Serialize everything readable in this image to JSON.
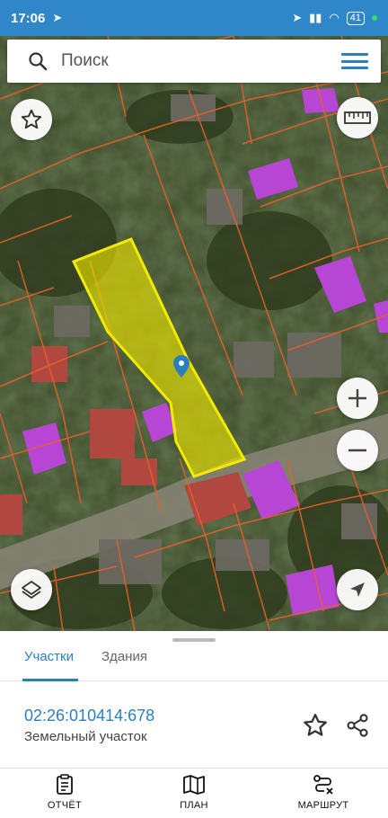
{
  "status_bar": {
    "time": "17:06",
    "battery": "41"
  },
  "search": {
    "placeholder": "Поиск"
  },
  "sheet": {
    "tabs": [
      {
        "label": "Участки",
        "active": true
      },
      {
        "label": "Здания",
        "active": false
      }
    ],
    "parcel": {
      "id": "02:26:010414:678",
      "type": "Земельный участок"
    }
  },
  "bottom_nav": [
    {
      "label": "ОТЧЁТ",
      "icon": "report-icon"
    },
    {
      "label": "ПЛАН",
      "icon": "map-plan-icon"
    },
    {
      "label": "МАРШРУТ",
      "icon": "route-icon"
    }
  ],
  "colors": {
    "accent": "#2a7fbf",
    "status_bar": "#2f86c8",
    "selected_parcel": "#e8e000",
    "building": "#c04fd8",
    "boundary": "#e8602a"
  }
}
